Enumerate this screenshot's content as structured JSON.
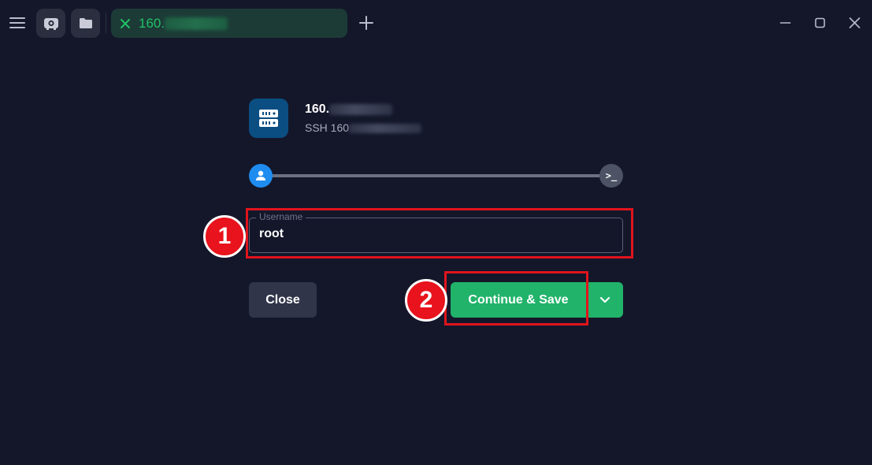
{
  "tab": {
    "label": "160.",
    "active_color": "#22c067"
  },
  "host": {
    "name_prefix": "160.",
    "subtitle_prefix": "SSH 160",
    "icon": "server-icon",
    "icon_bg": "#0a4e82"
  },
  "progress": {
    "steps": [
      "user-icon",
      "terminal-icon"
    ],
    "terminal_glyph": ">_",
    "current_step": 1,
    "total_steps": 2
  },
  "username_field": {
    "legend": "Username",
    "value": "root"
  },
  "buttons": {
    "close_label": "Close",
    "continue_label": "Continue & Save",
    "dropdown_icon": "chevron-down-icon"
  },
  "annotations": {
    "badge_one": "1",
    "badge_two": "2",
    "color": "#e0141c"
  },
  "colors": {
    "background": "#14172a",
    "accent_green": "#21b36a",
    "step_blue": "#1f8cf0"
  }
}
